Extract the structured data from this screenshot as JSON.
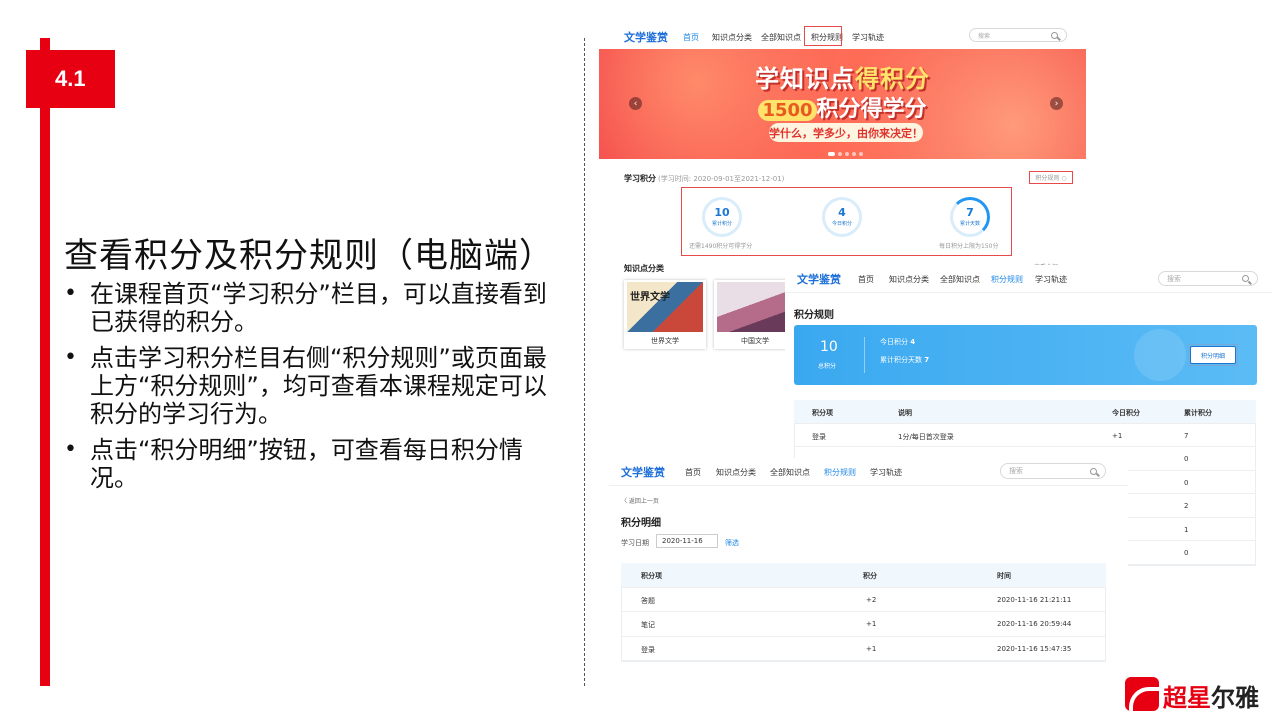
{
  "slide": {
    "section_number": "4.1",
    "title": "查看积分及积分规则（电脑端）",
    "bullets": [
      "在课程首页“学习积分”栏目，可以直接看到已获得的积分。",
      "点击学习积分栏目右侧“积分规则”或页面最上方“积分规则”，均可查看本课程规定可以积分的学习行为。",
      "点击“积分明细”按钮，可查看每日积分情况。"
    ]
  },
  "site": {
    "brand": "文学鉴赏",
    "nav": [
      "首页",
      "知识点分类",
      "全部知识点",
      "积分规则",
      "学习轨迹"
    ],
    "search_placeholder": "搜索"
  },
  "home": {
    "banner": {
      "headline_part1": "学知识点",
      "headline_part2": "得积分",
      "sub_digits": "1500",
      "sub_text": "积分得学分",
      "slogan": "学什么，学多少，由你来决定！",
      "prev_arrow": "‹",
      "next_arrow": "›"
    },
    "points_title": "学习积分",
    "points_period": "(学习时间: 2020-09-01至2021-12-01)",
    "rule_link": "积分规则 ○",
    "rings": [
      {
        "value": "10",
        "label": "累计积分"
      },
      {
        "value": "4",
        "label": "今日积分"
      },
      {
        "value": "7",
        "label": "累计天数"
      }
    ],
    "note_left": "还需1490积分可得学分",
    "note_right": "每日积分上限为150分",
    "kp_title": "知识点分类",
    "kp_more": "查看全部",
    "cards": [
      {
        "caption": "世界文学",
        "cover_text": "世界文学"
      },
      {
        "caption": "中国文学"
      }
    ]
  },
  "rules_page": {
    "title": "积分规则",
    "total_value": "10",
    "total_label": "总积分",
    "today_label": "今日积分",
    "today_value": "4",
    "days_label": "累计积分天数",
    "days_value": "7",
    "detail_button": "积分明细",
    "columns": [
      "积分项",
      "说明",
      "今日积分",
      "累计积分"
    ],
    "rows": [
      {
        "item": "登录",
        "desc": "1分/每日首次登录",
        "today": "+1",
        "total": "7"
      },
      {
        "item": "",
        "desc": "",
        "today": "",
        "total": "0"
      },
      {
        "item": "",
        "desc": "",
        "today": "",
        "total": "0"
      },
      {
        "item": "",
        "desc": "",
        "today": "",
        "total": "2"
      },
      {
        "item": "",
        "desc": "",
        "today": "",
        "total": "1"
      },
      {
        "item": "",
        "desc": "",
        "today": "",
        "total": "0"
      }
    ]
  },
  "detail_page": {
    "back": "〈 返回上一页",
    "title": "积分明细",
    "date_label": "学习日期",
    "date_value": "2020-11-16",
    "filter": "筛选",
    "columns": [
      "积分项",
      "积分",
      "时间"
    ],
    "rows": [
      {
        "item": "答题",
        "points": "+2",
        "time": "2020-11-16 21:21:11"
      },
      {
        "item": "笔记",
        "points": "+1",
        "time": "2020-11-16 20:59:44"
      },
      {
        "item": "登录",
        "points": "+1",
        "time": "2020-11-16 15:47:35"
      }
    ]
  },
  "logo": {
    "part1": "超星",
    "part2": "尔雅"
  }
}
